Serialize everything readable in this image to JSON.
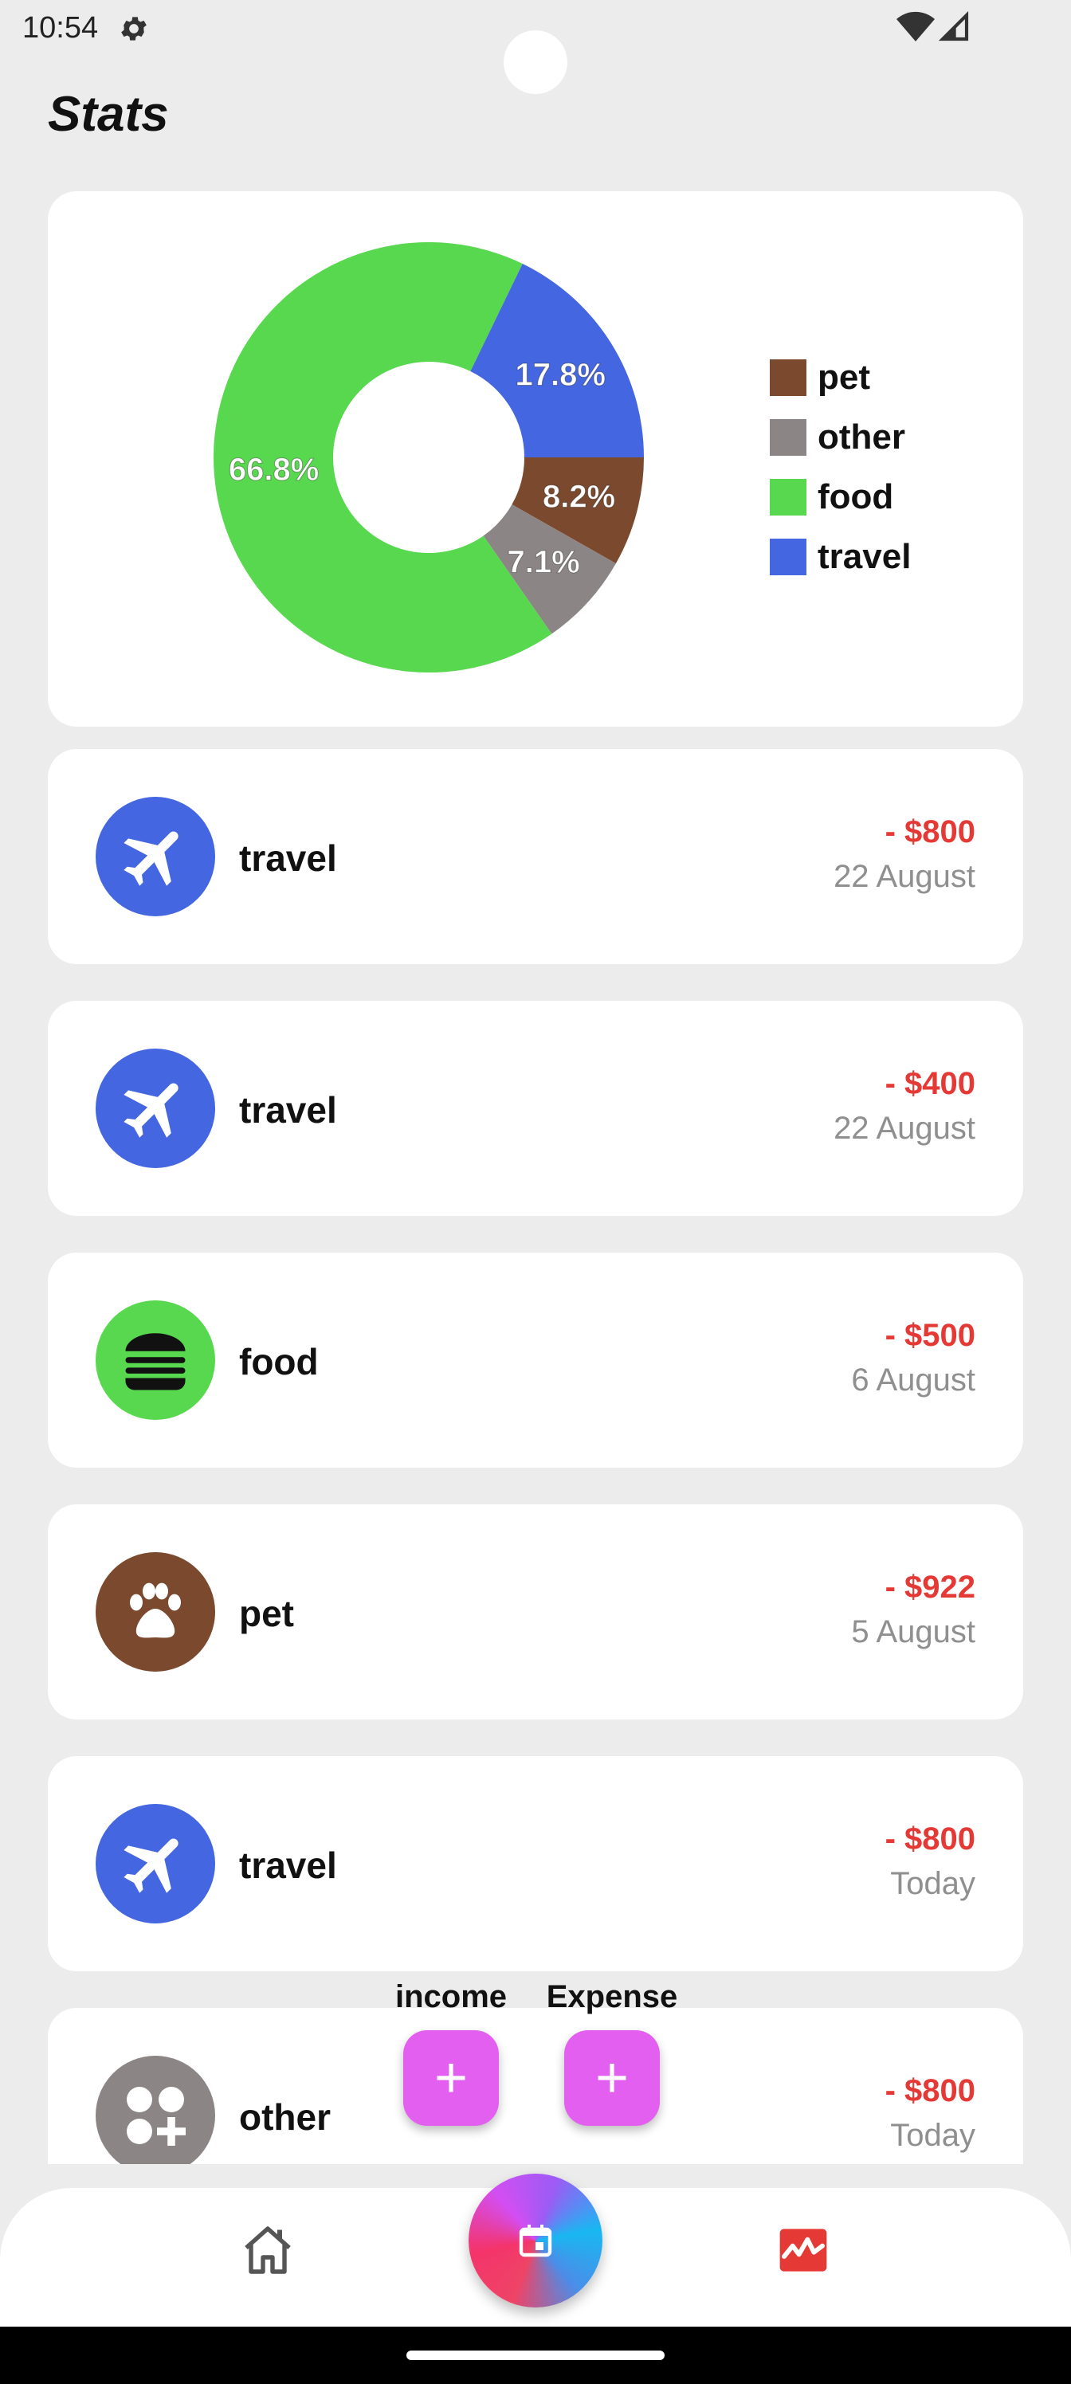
{
  "status_bar": {
    "time": "10:54"
  },
  "page": {
    "title": "Stats"
  },
  "colors": {
    "pet": "#7b4a2e",
    "other": "#8c8585",
    "food": "#58d84e",
    "travel": "#4466e0",
    "amount": "#e53935",
    "fab": "#e25ff0"
  },
  "chart_data": {
    "type": "pie",
    "donut": true,
    "legend_position": "right",
    "categories": [
      "pet",
      "other",
      "food",
      "travel"
    ],
    "values": [
      8.2,
      7.1,
      66.8,
      17.8
    ],
    "labels": [
      "8.2%",
      "7.1%",
      "66.8%",
      "17.8%"
    ],
    "colors": [
      "#7b4a2e",
      "#8c8585",
      "#58d84e",
      "#4466e0"
    ]
  },
  "transactions": [
    {
      "category": "travel",
      "icon": "airplane-icon",
      "amount": "- $800",
      "date": "22 August"
    },
    {
      "category": "travel",
      "icon": "airplane-icon",
      "amount": "- $400",
      "date": "22 August"
    },
    {
      "category": "food",
      "icon": "burger-icon",
      "amount": "- $500",
      "date": "6 August"
    },
    {
      "category": "pet",
      "icon": "paw-icon",
      "amount": "- $922",
      "date": "5 August"
    },
    {
      "category": "travel",
      "icon": "airplane-icon",
      "amount": "- $800",
      "date": "Today"
    },
    {
      "category": "other",
      "icon": "apps-plus-icon",
      "amount": "- $800",
      "date": "Today"
    }
  ],
  "fabs": {
    "income_label": "income",
    "expense_label": "Expense"
  },
  "nav": {
    "home_icon": "home-icon",
    "center_icon": "calendar-icon",
    "stats_icon": "stats-icon"
  }
}
